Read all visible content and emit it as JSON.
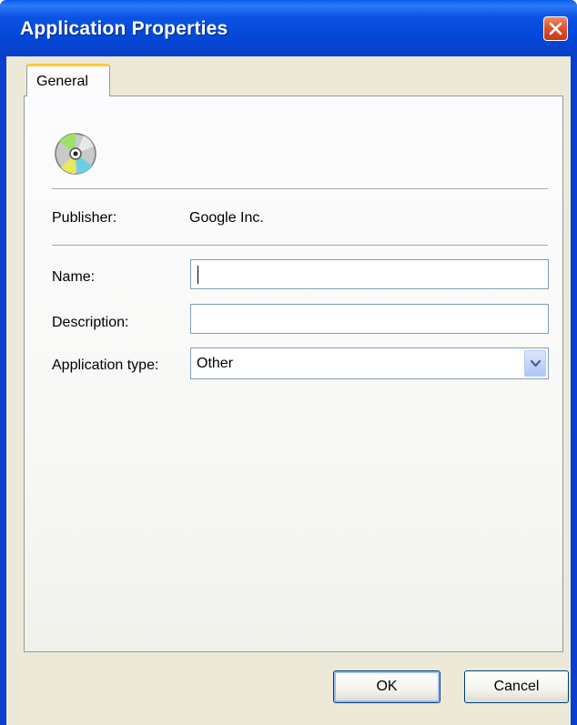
{
  "window": {
    "title": "Application Properties"
  },
  "tabs": [
    {
      "label": "General",
      "active": true
    }
  ],
  "general": {
    "app_icon": "cd-disc-icon",
    "publisher_label": "Publisher:",
    "publisher_value": "Google Inc.",
    "name_label": "Name:",
    "name_value": "",
    "description_label": "Description:",
    "description_value": "",
    "app_type_label": "Application type:",
    "app_type_value": "Other"
  },
  "buttons": {
    "ok": "OK",
    "cancel": "Cancel"
  },
  "colors": {
    "titlebar": "#0b52e3",
    "close_button": "#e0532f",
    "dialog_face": "#ece9d8",
    "tab_highlight": "#ffc83c",
    "input_border": "#7f9db9",
    "button_border": "#003c74"
  }
}
